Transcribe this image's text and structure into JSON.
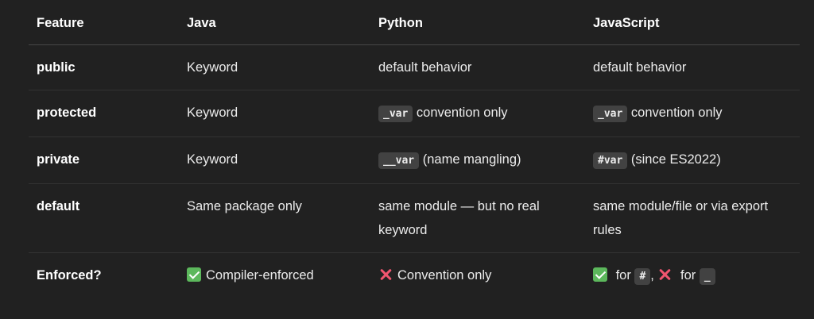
{
  "table": {
    "headers": [
      "Feature",
      "Java",
      "Python",
      "JavaScript"
    ],
    "rows": [
      {
        "feature": "public",
        "java": "Keyword",
        "python": "default behavior",
        "javascript": "default behavior"
      },
      {
        "feature": "protected",
        "java": "Keyword",
        "python_code": "_var",
        "python_text": " convention only",
        "javascript_code": "_var",
        "javascript_text": " convention only"
      },
      {
        "feature": "private",
        "java": "Keyword",
        "python_code": "__var",
        "python_text": " (name mangling)",
        "javascript_code": "#var",
        "javascript_text": " (since ES2022)"
      },
      {
        "feature": "default",
        "java": "Same package only",
        "python": "same module — but no real keyword",
        "javascript": "same module/file or via export rules"
      },
      {
        "feature": "Enforced?",
        "java_icon": "check-mark-icon",
        "java": "Compiler-enforced",
        "python_icon": "cross-mark-icon",
        "python": "Convention only",
        "js_part1_icon": "check-mark-icon",
        "js_part1_text": " for ",
        "js_part1_code": "#",
        "js_sep": ", ",
        "js_part2_icon": "cross-mark-icon",
        "js_part2_text": " for ",
        "js_part2_code": "_"
      }
    ]
  },
  "colors": {
    "background": "#212121",
    "text": "#ececec",
    "code_background": "#424242",
    "check_green": "#5cb85c",
    "cross_red": "#f0556f"
  }
}
